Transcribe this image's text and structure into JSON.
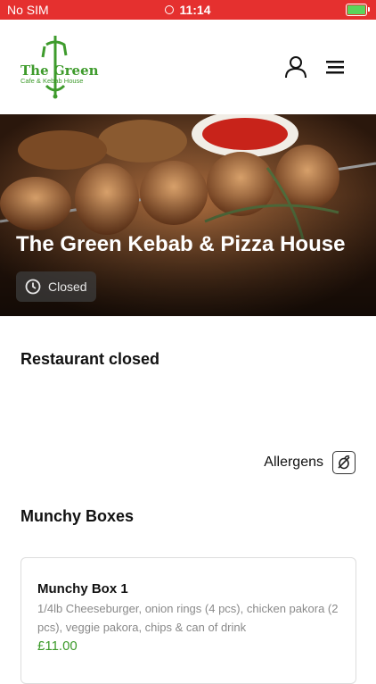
{
  "status_bar": {
    "carrier": "No SIM",
    "time": "11:14"
  },
  "header": {
    "logo_title": "The Green",
    "logo_subtitle": "Cafe & Kebab House",
    "icons": [
      "user-icon",
      "menu-icon"
    ]
  },
  "hero": {
    "restaurant_name": "The Green Kebab & Pizza House",
    "status": "Closed"
  },
  "notice": "Restaurant closed",
  "allergens_label": "Allergens",
  "category": {
    "title": "Munchy Boxes",
    "items": [
      {
        "name": "Munchy Box 1",
        "description": "1/4lb Cheeseburger, onion rings (4 pcs), chicken pakora (2 pcs), veggie pakora, chips & can of drink",
        "price": "£11.00"
      }
    ]
  },
  "colors": {
    "status_bar": "#e5302f",
    "brand_green": "#3e9b2c"
  }
}
